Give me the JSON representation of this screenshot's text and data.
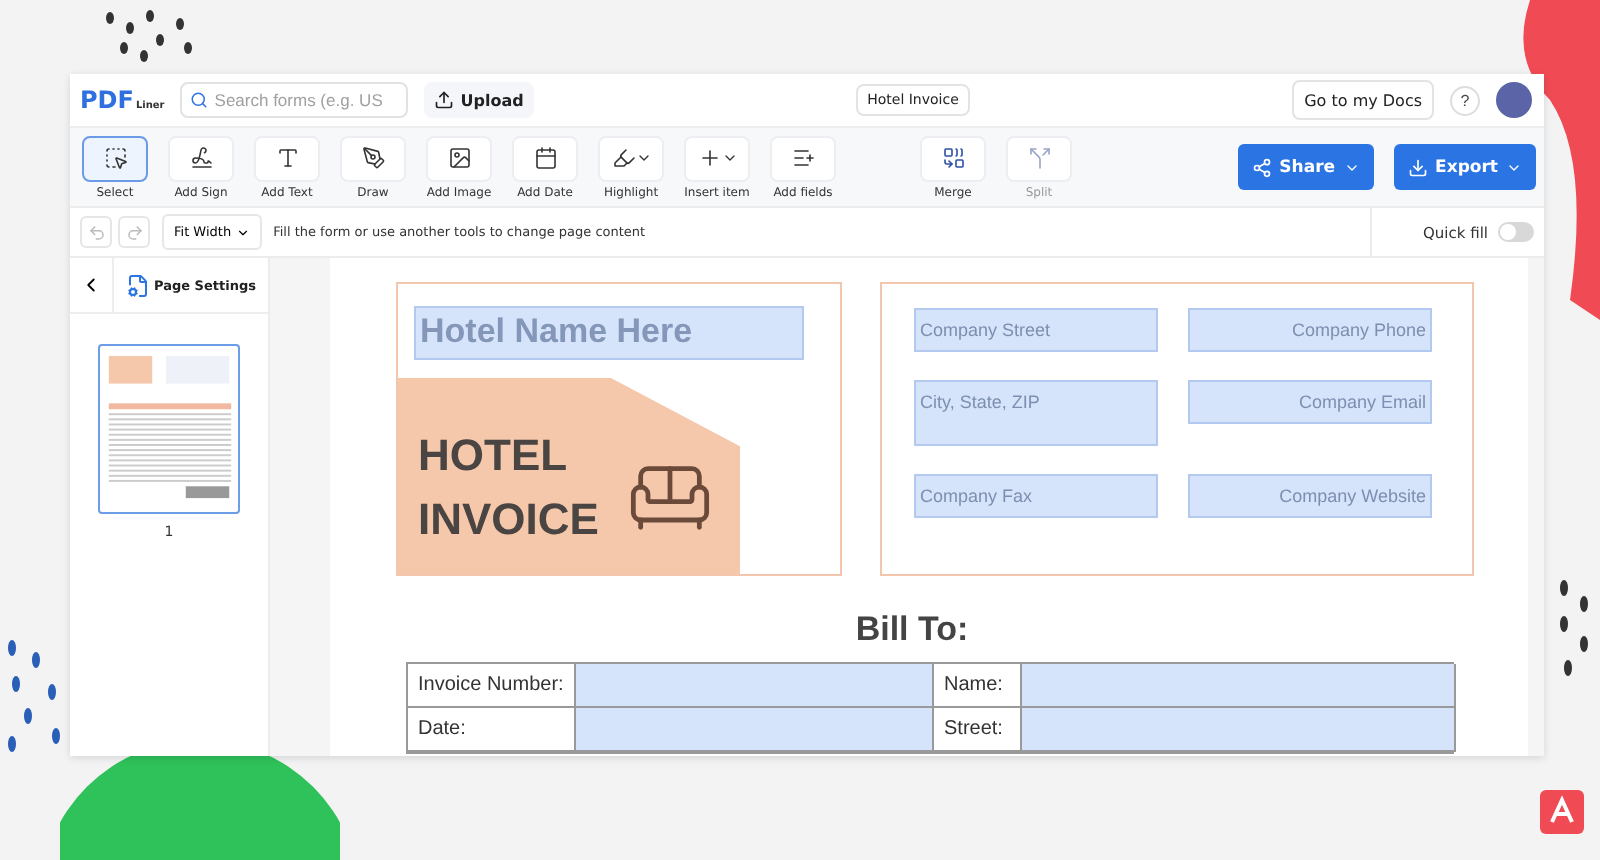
{
  "header": {
    "logo": "PDF",
    "logo_sub": "Liner",
    "search": {
      "placeholder": "Search forms (e.g. US"
    },
    "upload": "Upload",
    "doc_title": "Hotel Invoice",
    "go_docs": "Go to my Docs",
    "help": "?"
  },
  "tools": [
    {
      "label": "Select",
      "kind": "plain",
      "selected": true
    },
    {
      "label": "Add Sign",
      "kind": "plain",
      "selected": false
    },
    {
      "label": "Add Text",
      "kind": "plain",
      "selected": false
    },
    {
      "label": "Draw",
      "kind": "plain",
      "selected": false
    },
    {
      "label": "Add Image",
      "kind": "plain",
      "selected": false
    },
    {
      "label": "Add Date",
      "kind": "plain",
      "selected": false
    },
    {
      "label": "Highlight",
      "kind": "menu",
      "selected": false
    },
    {
      "label": "Insert item",
      "kind": "menu",
      "selected": false
    },
    {
      "label": "Add fields",
      "kind": "plain",
      "selected": false
    }
  ],
  "page_tools": [
    {
      "label": "Merge",
      "disabled": false
    },
    {
      "label": "Split",
      "disabled": true
    }
  ],
  "share": "Share",
  "export": "Export",
  "subbar": {
    "zoom": "Fit Width",
    "hint": "Fill the form or use another tools to change page content",
    "quick_fill": {
      "label": "Quick fill",
      "on": false
    }
  },
  "sidebar": {
    "page_settings": "Page Settings",
    "pages": [
      {
        "label": "1",
        "selected": true
      }
    ]
  },
  "document": {
    "hotel_name": {
      "placeholder": "Hotel Name Here"
    },
    "banner": [
      "HOTEL",
      "INVOICE"
    ],
    "company_fields": [
      {
        "placeholder": "Company Street"
      },
      {
        "placeholder": "Company Phone"
      },
      {
        "placeholder": "City, State, ZIP"
      },
      {
        "placeholder": "Company Email"
      },
      {
        "placeholder": "Company Fax"
      },
      {
        "placeholder": "Company Website"
      }
    ],
    "bill_to": "Bill To:",
    "rows": [
      [
        {
          "label": "Invoice Number:"
        },
        {
          "label": "Name:"
        }
      ],
      [
        {
          "label": "Date:"
        },
        {
          "label": "Street:"
        }
      ]
    ]
  }
}
